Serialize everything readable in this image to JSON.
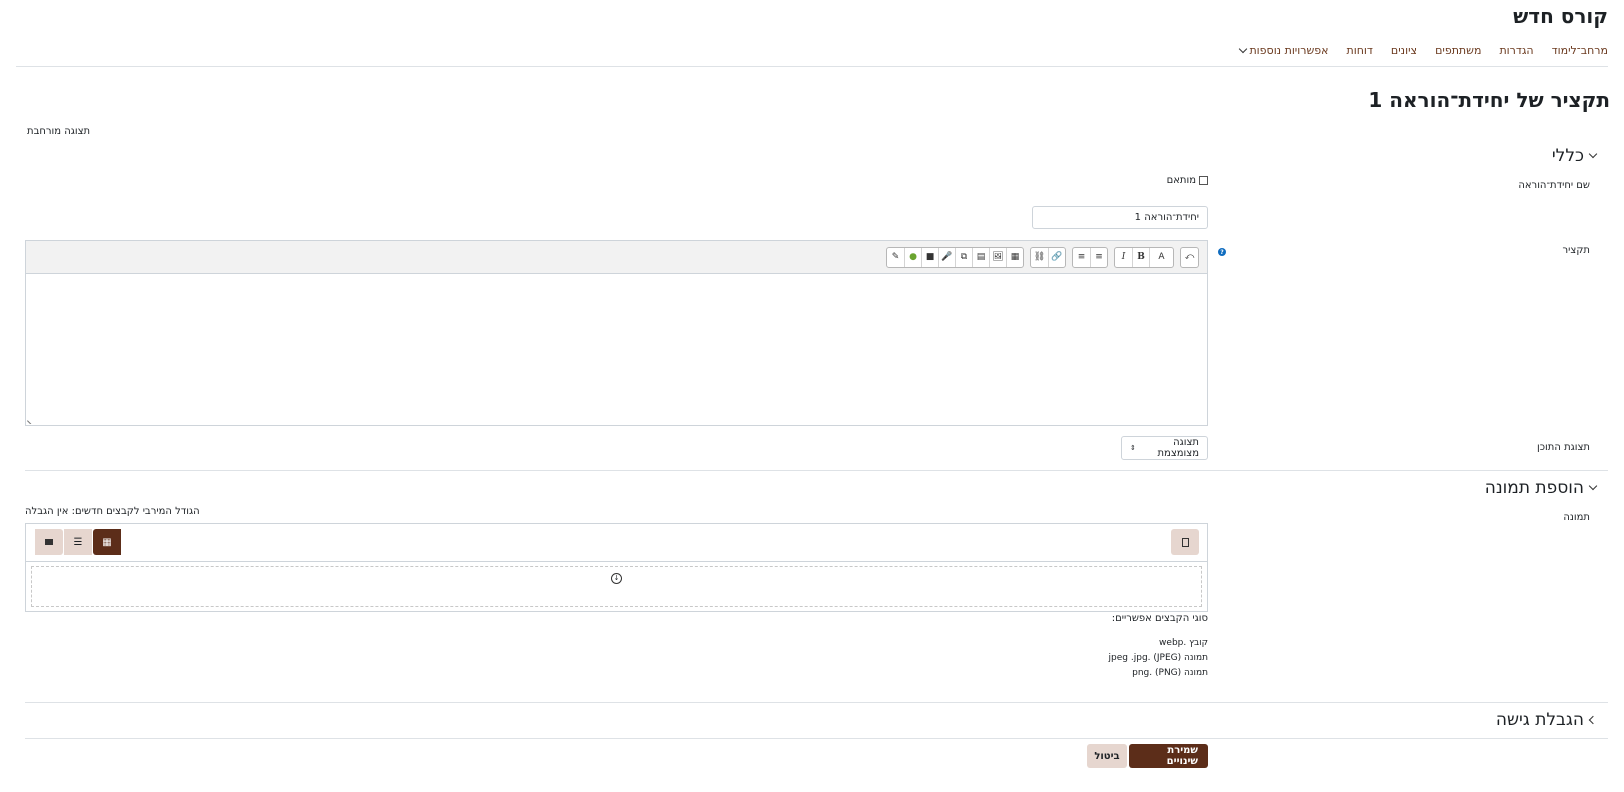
{
  "course": {
    "title": "קורס חדש"
  },
  "nav": {
    "items": [
      "מרחב־לימוד",
      "הגדרות",
      "משתתפים",
      "ציונים",
      "דוחות"
    ],
    "more_label": "אפשרויות נוספות"
  },
  "page": {
    "title": "תקציר של יחידת־הוראה 1",
    "expand_all": "תצוגה מורחבת"
  },
  "general": {
    "section_title": "כללי",
    "name_label": "שם יחידת־הוראה",
    "custom_label": "מותאם",
    "name_value": "יחידת־הוראה 1",
    "summary_label": "תקציר",
    "content_display_label": "תצוגת התוכן",
    "content_display_value": "תצוגה מצומצמת"
  },
  "editor": {
    "buttons": {
      "undo": "⤺",
      "font": "A",
      "bold": "B",
      "italic": "I",
      "ul": "≡",
      "ol": "≡",
      "link": "🔗",
      "unlink": "⛓",
      "template": "▦",
      "image": "🖼",
      "media": "▤",
      "copy": "⧉",
      "mic": "🎤",
      "video": "■",
      "h5p": "●",
      "annotate": "✎"
    },
    "help_glyph": "?"
  },
  "image": {
    "section_title": "הוספת תמונה",
    "label": "תמונה",
    "max_size": "הגודל המירבי לקבצים חדשים: אין הגבלה",
    "accepted_title": "סוגי הקבצים אפשריים:",
    "types": [
      "קובץ .webp",
      "תמונה (JPEG) .jpeg .jpg",
      "תמונה (PNG) .png"
    ]
  },
  "access": {
    "section_title": "הגבלת גישה"
  },
  "actions": {
    "save": "שמירת שינויים",
    "cancel": "ביטול"
  },
  "colors": {
    "brand": "#5c2d19",
    "link": "#6b3a1f",
    "help": "#0f6cbf",
    "button_secondary": "#e6d6cf"
  }
}
